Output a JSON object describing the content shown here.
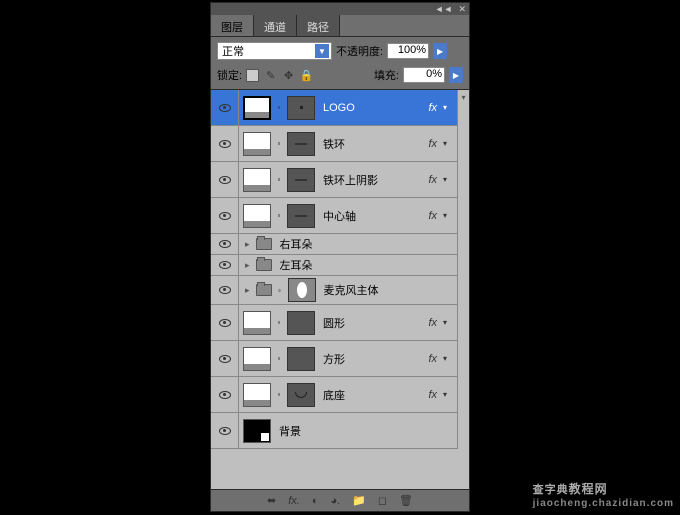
{
  "titlebar": {
    "collapse": "◄◄",
    "close": "✕"
  },
  "tabs": {
    "layers": "图层",
    "channels": "通道",
    "paths": "路径"
  },
  "controls": {
    "blend_mode": "正常",
    "opacity_label": "不透明度:",
    "opacity_value": "100%",
    "lock_label": "锁定:",
    "fill_label": "填充:",
    "fill_value": "0%"
  },
  "layers": [
    {
      "name": "LOGO",
      "type": "masked",
      "selected": true,
      "fx": true,
      "mask_content": "dot"
    },
    {
      "name": "铁环",
      "type": "masked",
      "fx": true,
      "mask_content": "dash"
    },
    {
      "name": "铁环上阴影",
      "type": "masked",
      "fx": true,
      "mask_content": "dash"
    },
    {
      "name": "中心轴",
      "type": "masked",
      "fx": true,
      "mask_content": "dash"
    },
    {
      "name": "右耳朵",
      "type": "group"
    },
    {
      "name": "左耳朵",
      "type": "group"
    },
    {
      "name": "麦克风主体",
      "type": "group_linked",
      "mask_content": "oval"
    },
    {
      "name": "圆形",
      "type": "masked",
      "fx": true,
      "mask_content": ""
    },
    {
      "name": "方形",
      "type": "masked",
      "fx": true,
      "mask_content": ""
    },
    {
      "name": "底座",
      "type": "masked",
      "fx": true,
      "mask_content": "smile"
    },
    {
      "name": "背景",
      "type": "bg"
    }
  ],
  "fx_label": "fx",
  "footer_icons": [
    "⬌",
    "fx.",
    "◐",
    "◕.",
    "📁",
    "◻",
    "🗑"
  ],
  "watermark": {
    "main": "查字典",
    "sub": "教程网",
    "url": "jiaocheng.chazidian.com"
  }
}
